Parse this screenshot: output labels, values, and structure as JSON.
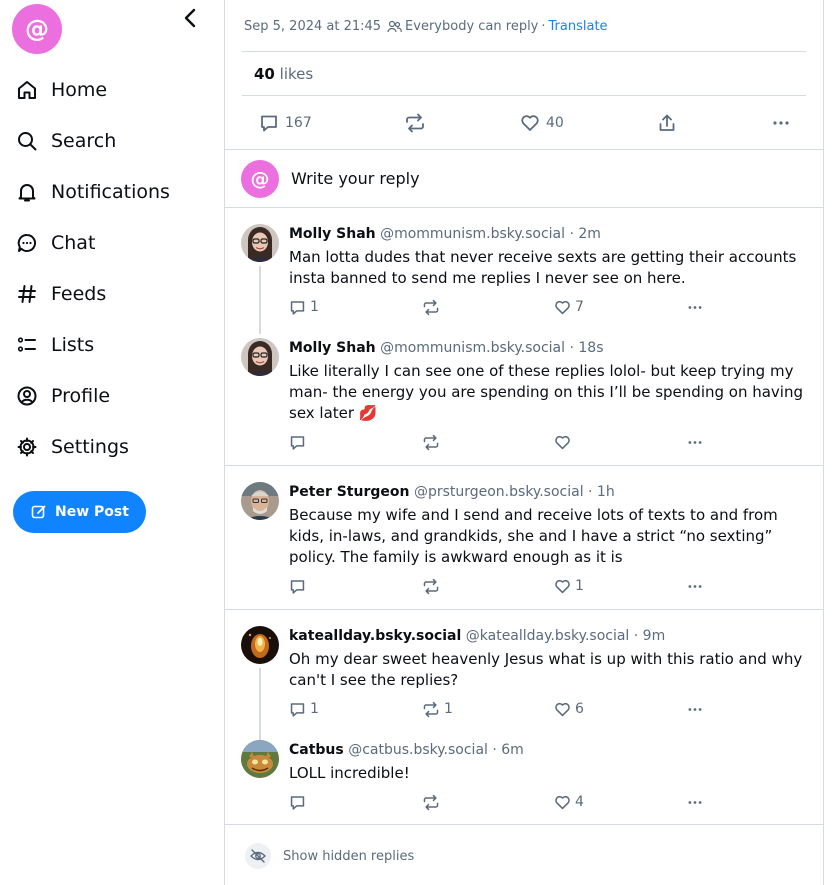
{
  "app": {
    "logo": "@"
  },
  "nav": [
    {
      "label": "Home",
      "icon": "home-icon"
    },
    {
      "label": "Search",
      "icon": "search-icon"
    },
    {
      "label": "Notifications",
      "icon": "bell-icon"
    },
    {
      "label": "Chat",
      "icon": "chat-icon"
    },
    {
      "label": "Feeds",
      "icon": "hash-icon"
    },
    {
      "label": "Lists",
      "icon": "list-icon"
    },
    {
      "label": "Profile",
      "icon": "profile-icon"
    },
    {
      "label": "Settings",
      "icon": "gear-icon"
    }
  ],
  "new_post": {
    "label": "New Post"
  },
  "main_post": {
    "date": "Sep 5, 2024 at 21:45",
    "reply_setting": "Everybody can reply",
    "separator": "·",
    "translate": "Translate",
    "likes_count": "40",
    "likes_label": "likes",
    "reply_count": "167",
    "like_count": "40"
  },
  "reply_box": {
    "avatar": "@",
    "placeholder": "Write your reply"
  },
  "replies": [
    {
      "name": "Molly Shah",
      "handle": "@mommunism.bsky.social",
      "time": "· 2m",
      "text": "Man lotta dudes that never receive sexts are getting their accounts insta banned to send me replies I never see on here.",
      "replies": "1",
      "reposts": "",
      "likes": "7"
    },
    {
      "name": "Molly Shah",
      "handle": "@mommunism.bsky.social",
      "time": "· 18s",
      "text": "Like literally I can see one of these replies lolol- but keep trying my man- the energy you are spending on this I’ll be spending on having sex later 💋",
      "replies": "",
      "reposts": "",
      "likes": ""
    },
    {
      "name": "Peter Sturgeon",
      "handle": "@prsturgeon.bsky.social",
      "time": "· 1h",
      "text": "Because my wife and I send and receive lots of texts to and from kids, in-laws, and grandkids, she and I have a strict “no sexting” policy. The family is awkward enough as it is",
      "replies": "",
      "reposts": "",
      "likes": "1"
    },
    {
      "name": "kateallday.bsky.social",
      "handle": "@kateallday.bsky.social",
      "time": "· 9m",
      "text": "Oh my dear sweet heavenly Jesus what is up with this ratio and why can't I see the replies?",
      "replies": "1",
      "reposts": "1",
      "likes": "6"
    },
    {
      "name": "Catbus",
      "handle": "@catbus.bsky.social",
      "time": "· 6m",
      "text": "LOLL incredible!",
      "replies": "",
      "reposts": "",
      "likes": "4"
    }
  ],
  "hidden_replies": {
    "label": "Show hidden replies"
  },
  "colors": {
    "accent": "#1083fe",
    "logo": "#ec6fe0",
    "muted": "#5a6b7e",
    "border": "#d4dbe2"
  }
}
